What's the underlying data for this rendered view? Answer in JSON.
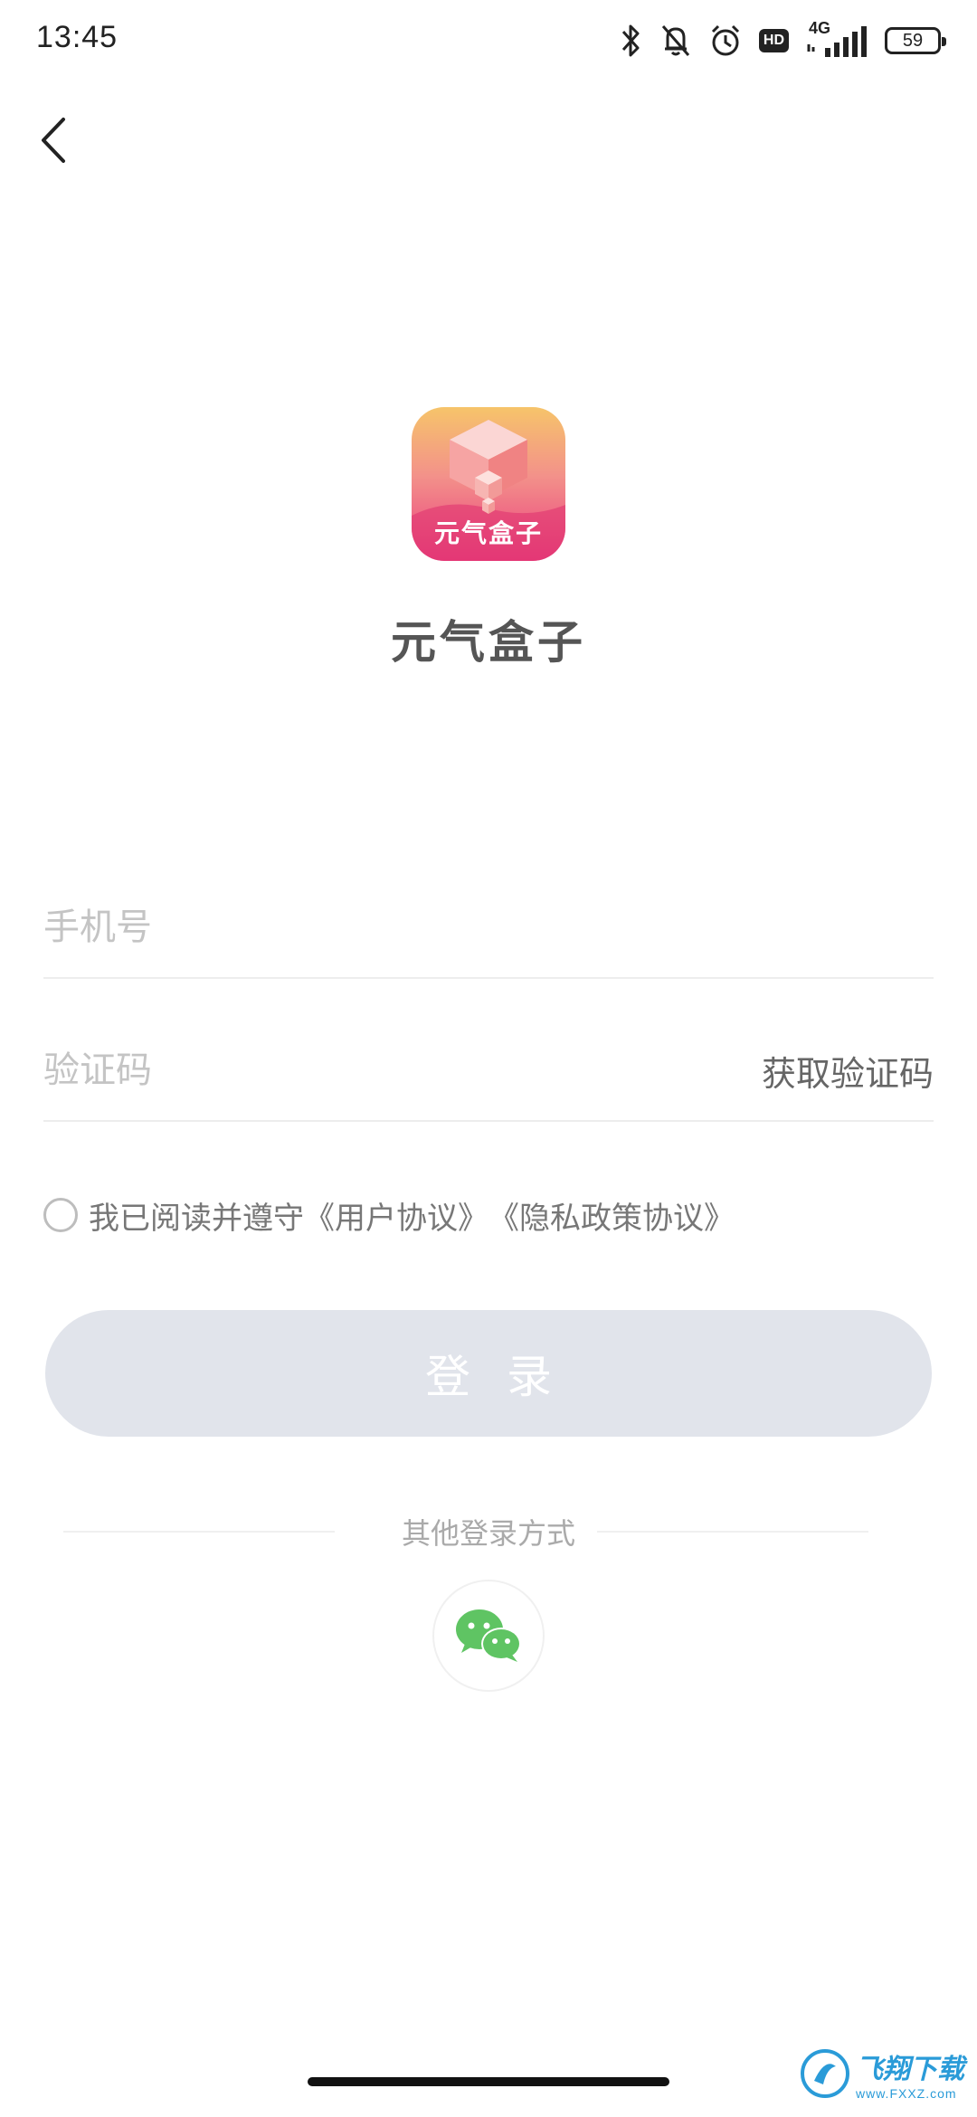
{
  "status_bar": {
    "time": "13:45",
    "network_type": "4G",
    "hd_label": "HD",
    "battery_level": "59"
  },
  "app": {
    "logo_text": "元气盒子",
    "name": "元气盒子",
    "logo_gradient": [
      "#f6c46a",
      "#f3918a",
      "#ea3d7e"
    ]
  },
  "form": {
    "phone": {
      "placeholder": "手机号",
      "value": ""
    },
    "code": {
      "placeholder": "验证码",
      "value": ""
    },
    "get_code_label": "获取验证码"
  },
  "agreement": {
    "text": "我已阅读并遵守",
    "user_agreement": "《用户协议》",
    "privacy_policy": "《隐私政策协议》",
    "checked": false
  },
  "login_button": {
    "label": "登录",
    "disabled_color": "#e1e4eb"
  },
  "other_login": {
    "title": "其他登录方式",
    "wechat_color": "#5fc463"
  },
  "watermark": {
    "text": "飞翔下载",
    "sub": "www.FXXZ.com"
  }
}
